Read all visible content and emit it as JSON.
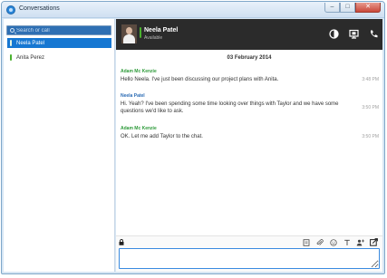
{
  "window": {
    "title": "Conversations"
  },
  "sidebar": {
    "search_placeholder": "Search or call",
    "contacts": [
      {
        "name": "Neela Patel",
        "status": "Available",
        "active": true
      },
      {
        "name": "Anita Perez",
        "status": "Available",
        "active": false
      }
    ]
  },
  "header": {
    "name": "Neela Patel",
    "status": "Available",
    "icons": [
      "contrast-icon",
      "screen-share-icon",
      "phone-icon"
    ]
  },
  "conversation": {
    "date": "03 February 2014",
    "messages": [
      {
        "sender": "Adam Mc Kenzie",
        "text": "Hello Neela. I've just been discussing our project plans with Anita.",
        "time": "3:48 PM"
      },
      {
        "sender": "Neela Patel",
        "text": "Hi. Yeah? I've been spending some time looking over things with Taylor and we have some questions we'd like to ask.",
        "time": "3:50 PM"
      },
      {
        "sender": "Adam Mc Kenzie",
        "text": "OK. Let me add Taylor to the chat.",
        "time": "3:50 PM"
      }
    ]
  },
  "compose": {
    "placeholder": "",
    "tools": [
      "document-icon",
      "attach-icon",
      "emoji-icon",
      "text-format-icon",
      "add-person-icon",
      "popout-icon"
    ]
  },
  "colors": {
    "accent": "#1677d2",
    "presence": "#4ab22e",
    "header_bg": "#2b2b2b"
  }
}
